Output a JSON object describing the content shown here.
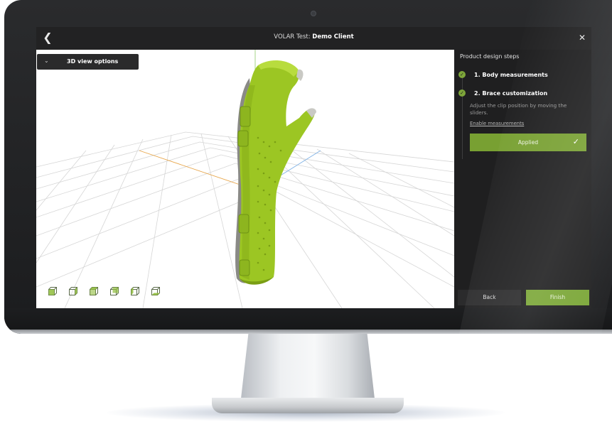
{
  "header": {
    "back_icon": "chevron-left-icon",
    "title_prefix": "VOLAR Test: ",
    "title_client": "Demo Client",
    "close_icon": "close-icon"
  },
  "viewer": {
    "view_options_label": "3D view options",
    "view_options_icon": "chevron-down-icon",
    "view_presets": [
      "view-cube-1-icon",
      "view-cube-2-icon",
      "view-cube-3-icon",
      "view-cube-4-icon",
      "view-cube-5-icon",
      "view-cube-6-icon"
    ],
    "model": "wrist-brace"
  },
  "panel": {
    "heading": "Product design steps",
    "steps": [
      {
        "label": "1. Body measurements",
        "status": "done"
      },
      {
        "label": "2. Brace customization",
        "status": "done"
      }
    ],
    "description": "Adjust the clip position by moving the sliders.",
    "enable_link": "Enable measurements",
    "applied_label": "Applied",
    "back_label": "Back",
    "finish_label": "Finish"
  },
  "colors": {
    "accent": "#7aa636",
    "brace_green": "#9cc623",
    "panel_bg": "#1f1f20"
  }
}
